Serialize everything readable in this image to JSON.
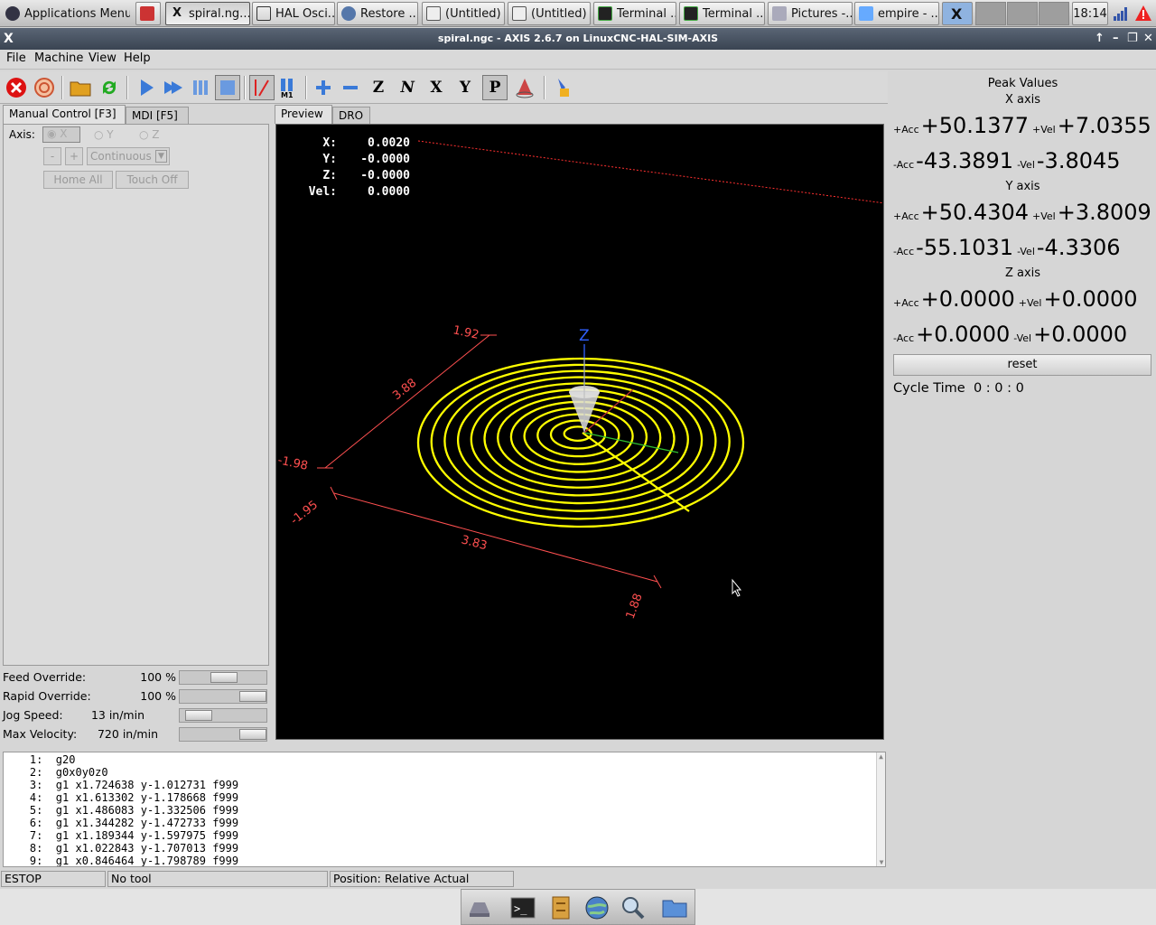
{
  "taskbar": {
    "apps_menu": "Applications Menu",
    "items": [
      {
        "label": "spiral.ng...",
        "active": true
      },
      {
        "label": "HAL Osci..."
      },
      {
        "label": "Restore ..."
      },
      {
        "label": "(Untitled)"
      },
      {
        "label": "(Untitled)"
      },
      {
        "label": "Terminal ..."
      },
      {
        "label": "Terminal ..."
      },
      {
        "label": "Pictures -..."
      },
      {
        "label": "empire - ..."
      }
    ],
    "clock": "18:14"
  },
  "window": {
    "title": "spiral.ngc - AXIS 2.6.7 on LinuxCNC-HAL-SIM-AXIS"
  },
  "menu": [
    "File",
    "Machine",
    "View",
    "Help"
  ],
  "toolbar_icons": [
    "estop-icon",
    "power-icon",
    "open-file-icon",
    "reload-icon",
    "run-icon",
    "step-icon",
    "pause-icon",
    "stop-icon",
    "block-delete-icon",
    "optional-stop-icon",
    "zoom-in-icon",
    "zoom-out-icon",
    "view-z-icon",
    "view-z2-icon",
    "view-x-icon",
    "view-y-icon",
    "view-p-icon",
    "rotate-icon",
    "clear-plot-icon"
  ],
  "left": {
    "tabs": [
      "Manual Control [F3]",
      "MDI [F5]"
    ],
    "axis_label": "Axis:",
    "axes": [
      "X",
      "Y",
      "Z"
    ],
    "jog_minus": "-",
    "jog_plus": "+",
    "jog_mode": "Continuous",
    "home_all": "Home All",
    "touch_off": "Touch Off",
    "overrides": [
      {
        "label": "Feed Override:",
        "value": "100 %",
        "level": 0.5
      },
      {
        "label": "Rapid Override:",
        "value": "100 %",
        "level": 1.0
      },
      {
        "label": "Jog Speed:",
        "value": "13 in/min",
        "level": 0.2
      },
      {
        "label": "Max Velocity:",
        "value": "720 in/min",
        "level": 1.0
      }
    ]
  },
  "preview": {
    "tabs": [
      "Preview",
      "DRO"
    ],
    "dro": [
      {
        "axis": "X:",
        "value": "0.0020"
      },
      {
        "axis": "Y:",
        "value": "-0.0000"
      },
      {
        "axis": "Z:",
        "value": "-0.0000"
      },
      {
        "axis": "Vel:",
        "value": "0.0000"
      }
    ],
    "dims": {
      "top_left": "1.92",
      "left_len": "3.88",
      "left_bottom": "-1.98",
      "bottom_left": "-1.95",
      "bottom_len": "3.83",
      "bottom_right": "1.88"
    },
    "axis_z": "Z"
  },
  "peak": {
    "title": "Peak Values",
    "axes": [
      {
        "name": "X axis",
        "pacc": "+50.1377",
        "pvel": "+7.0355",
        "nacc": "-43.3891",
        "nvel": "-3.8045"
      },
      {
        "name": "Y axis",
        "pacc": "+50.4304",
        "pvel": "+3.8009",
        "nacc": "-55.1031",
        "nvel": "-4.3306"
      },
      {
        "name": "Z axis",
        "pacc": "+0.0000",
        "pvel": "+0.0000",
        "nacc": "+0.0000",
        "nvel": "+0.0000"
      }
    ],
    "labels": {
      "pacc": "+Acc",
      "pvel": "+Vel",
      "nacc": "-Acc",
      "nvel": "-Vel"
    },
    "reset": "reset",
    "cycle_time": "Cycle Time  0 : 0 : 0"
  },
  "gcode": [
    "    1:  g20",
    "    2:  g0x0y0z0",
    "    3:  g1 x1.724638 y-1.012731 f999",
    "    4:  g1 x1.613302 y-1.178668 f999",
    "    5:  g1 x1.486083 y-1.332506 f999",
    "    6:  g1 x1.344282 y-1.472733 f999",
    "    7:  g1 x1.189344 y-1.597975 f999",
    "    8:  g1 x1.022843 y-1.707013 f999",
    "    9:  g1 x0.846464 y-1.798789 f999"
  ],
  "status": {
    "machine": "ESTOP",
    "tool": "No tool",
    "position": "Position: Relative Actual"
  },
  "colors": {
    "toolpath": "#ffff00",
    "dims": "#ff4040",
    "background": "#000000"
  }
}
